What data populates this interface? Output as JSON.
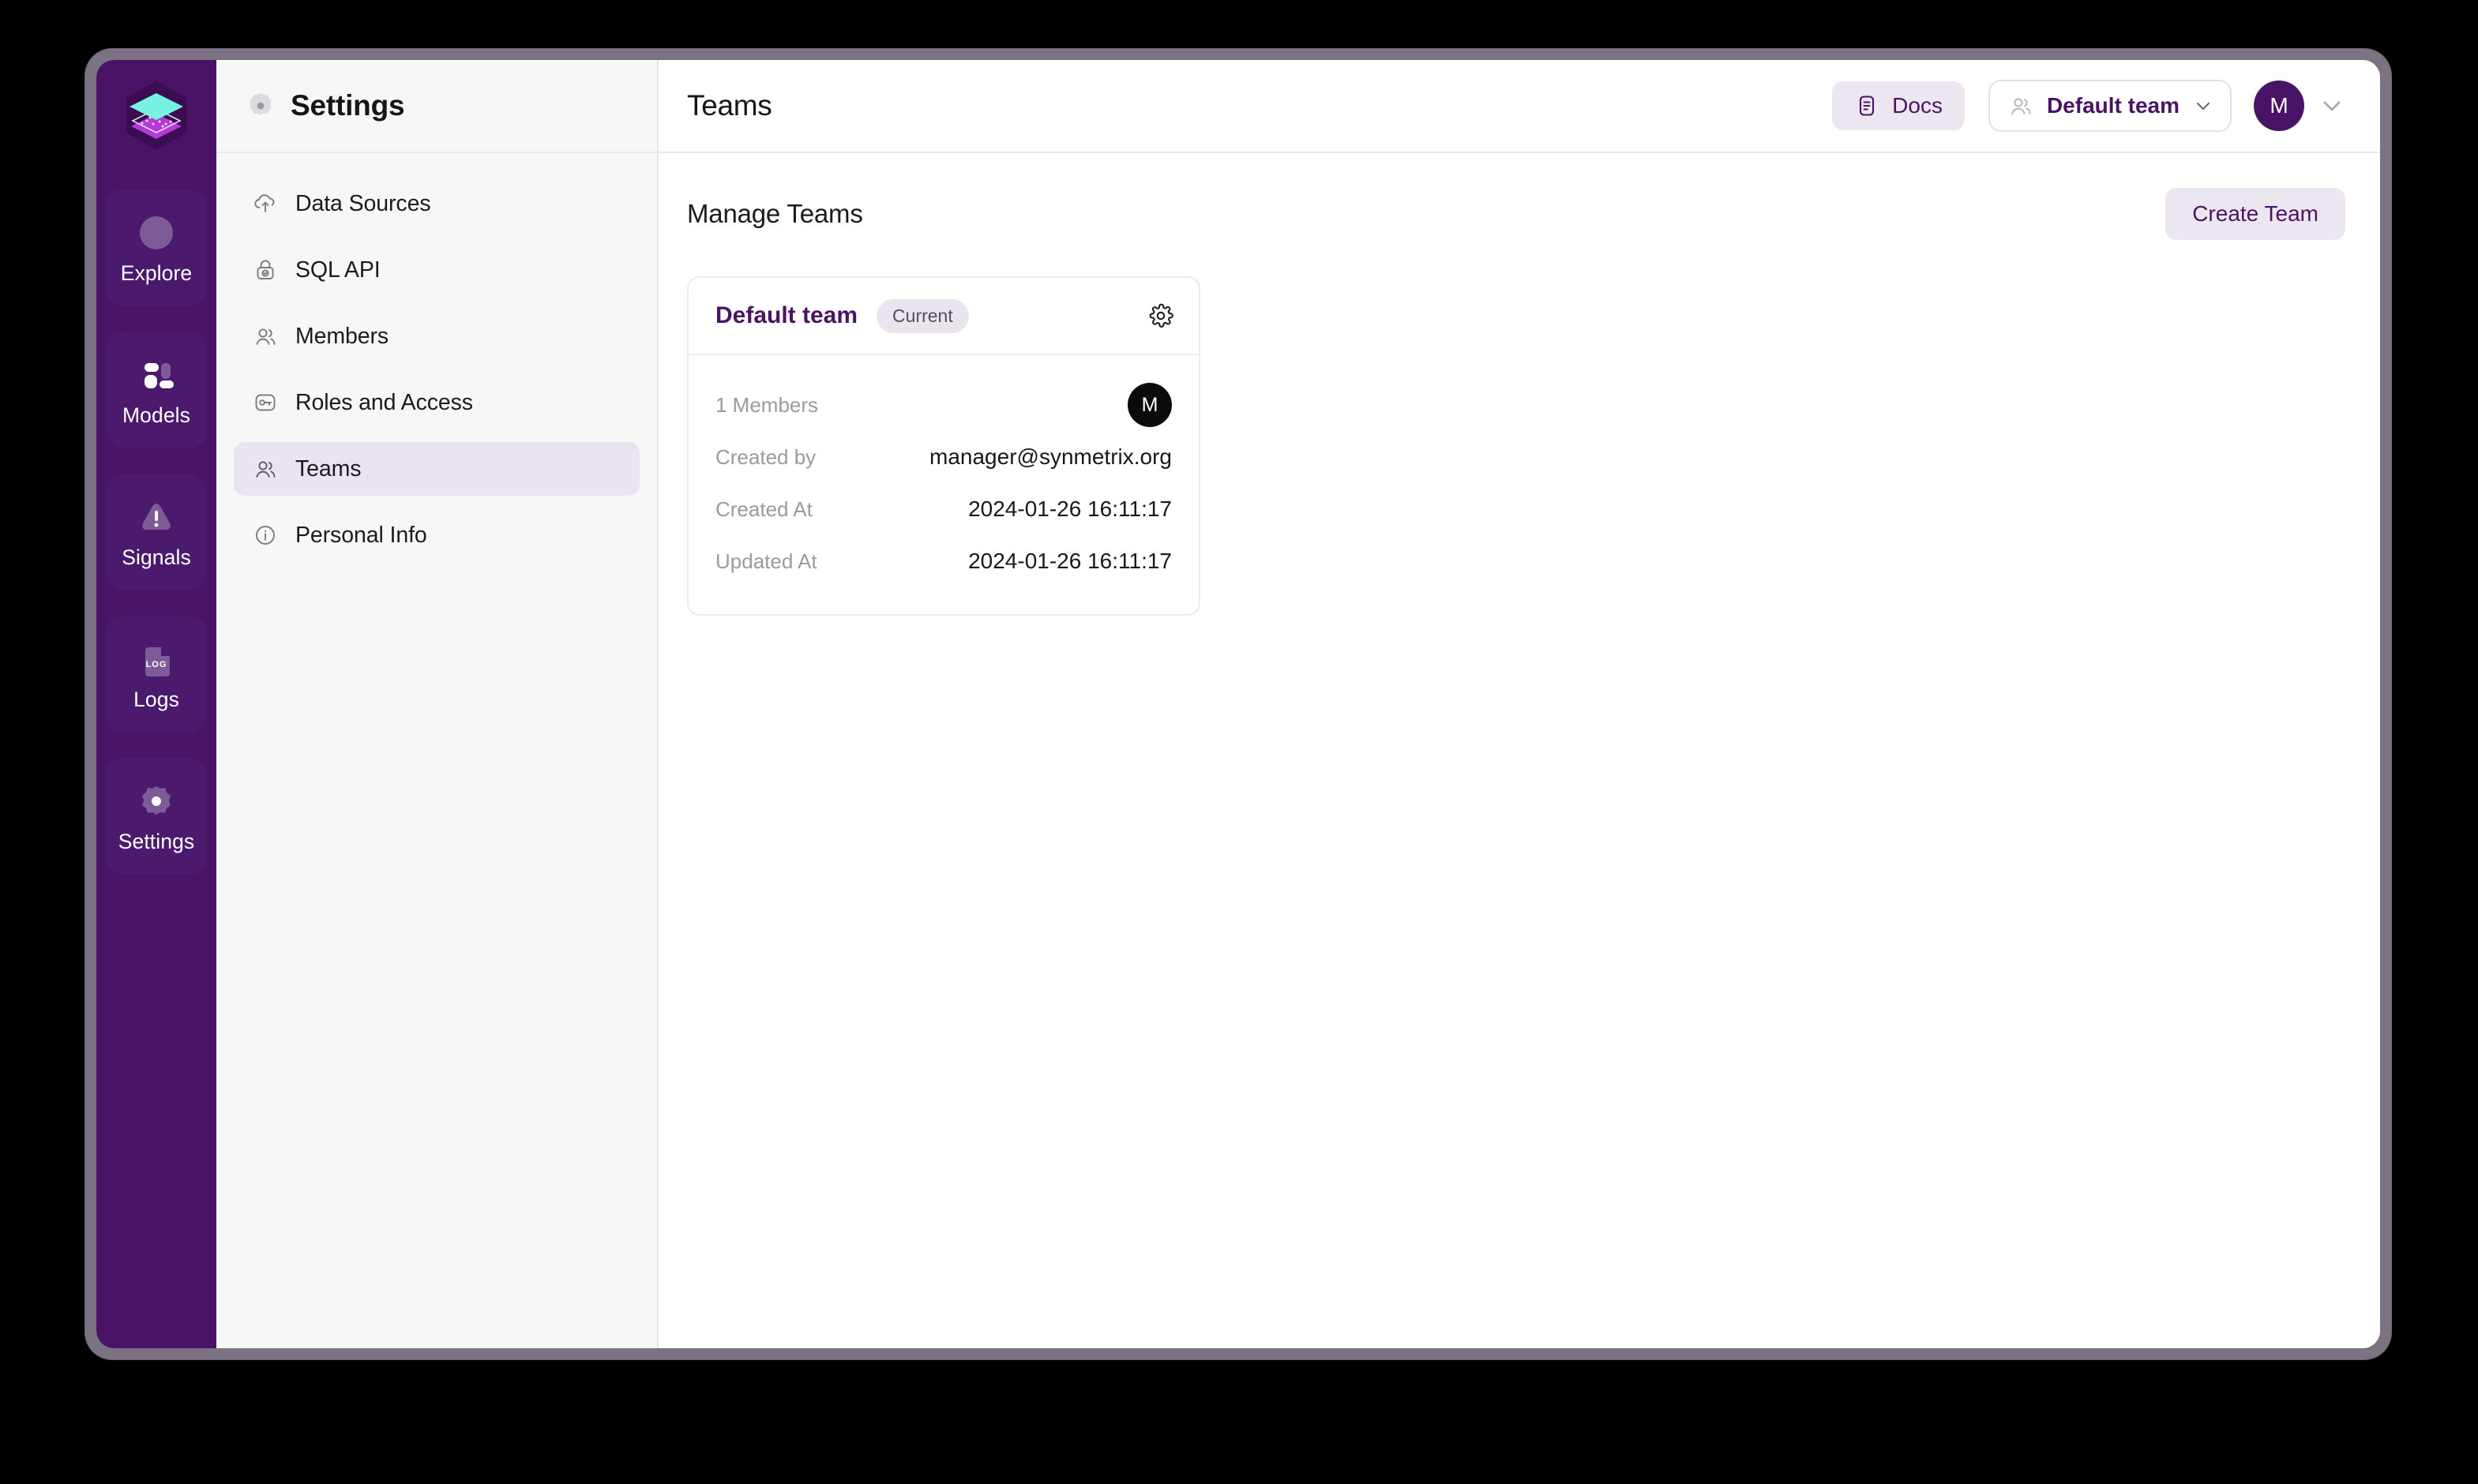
{
  "window": {
    "frame_color": "#7d7184"
  },
  "rail": {
    "brand_color": "#4a1466",
    "logo_icon": "synmetrix-layers-logo",
    "items": [
      {
        "label": "Explore",
        "icon": "compass-icon",
        "active": false
      },
      {
        "label": "Models",
        "icon": "models-blocks-icon",
        "active": false
      },
      {
        "label": "Signals",
        "icon": "alert-triangle-icon",
        "active": false
      },
      {
        "label": "Logs",
        "icon": "log-file-icon",
        "active": false
      },
      {
        "label": "Settings",
        "icon": "gear-icon",
        "active": true
      }
    ]
  },
  "settings_nav": {
    "title": "Settings",
    "title_icon": "gear-filled-icon",
    "items": [
      {
        "label": "Data Sources",
        "icon": "cloud-upload-icon",
        "active": false
      },
      {
        "label": "SQL API",
        "icon": "lock-check-icon",
        "active": false
      },
      {
        "label": "Members",
        "icon": "users-icon",
        "active": false
      },
      {
        "label": "Roles and Access",
        "icon": "key-card-icon",
        "active": false
      },
      {
        "label": "Teams",
        "icon": "users-icon",
        "active": true
      },
      {
        "label": "Personal Info",
        "icon": "info-circle-icon",
        "active": false
      }
    ]
  },
  "header": {
    "page_title": "Teams",
    "docs_label": "Docs",
    "docs_icon": "document-icon",
    "team_switcher_label": "Default team",
    "team_switcher_icon": "users-icon",
    "team_switcher_chevron": "chevron-down-icon",
    "avatar_initial": "M",
    "avatar_chevron": "chevron-down-icon",
    "accent_color": "#4a1466"
  },
  "content": {
    "section_title": "Manage Teams",
    "create_team_label": "Create Team",
    "team_card": {
      "name": "Default team",
      "badge": "Current",
      "settings_icon": "gear-icon",
      "rows": [
        {
          "label": "1 Members",
          "value": "",
          "avatar": "M"
        },
        {
          "label": "Created by",
          "value": "manager@synmetrix.org"
        },
        {
          "label": "Created At",
          "value": "2024-01-26 16:11:17"
        },
        {
          "label": "Updated At",
          "value": "2024-01-26 16:11:17"
        }
      ]
    }
  }
}
